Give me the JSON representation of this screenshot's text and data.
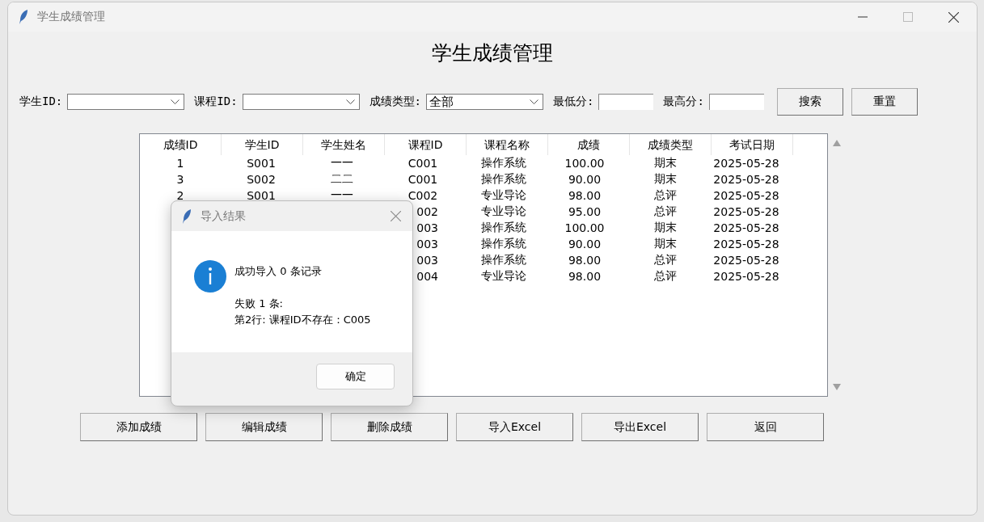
{
  "window": {
    "title": "学生成绩管理"
  },
  "heading": "学生成绩管理",
  "filters": [
    {
      "kind": "combo",
      "label": "学生ID:"
    },
    {
      "kind": "combo",
      "label": "课程ID:"
    },
    {
      "kind": "combo",
      "label": "成绩类型:",
      "value": "全部"
    },
    {
      "kind": "entry",
      "label": "最低分:"
    },
    {
      "kind": "entry",
      "label": "最高分:"
    }
  ],
  "filter_buttons": [
    "搜索",
    "重置"
  ],
  "table": {
    "columns": [
      "成绩ID",
      "学生ID",
      "学生姓名",
      "课程ID",
      "课程名称",
      "成绩",
      "成绩类型",
      "考试日期"
    ],
    "rows": [
      [
        "1",
        "S001",
        "一一",
        "C001",
        "操作系统",
        "100.00",
        "期末",
        "2025-05-28"
      ],
      [
        "3",
        "S002",
        "二二",
        "C001",
        "操作系统",
        "90.00",
        "期末",
        "2025-05-28"
      ],
      [
        "2",
        "S001",
        "一一",
        "C002",
        "专业导论",
        "98.00",
        "总评",
        "2025-05-28"
      ],
      [
        null,
        null,
        null,
        "002",
        "专业导论",
        "95.00",
        "总评",
        "2025-05-28"
      ],
      [
        null,
        null,
        null,
        "003",
        "操作系统",
        "100.00",
        "期末",
        "2025-05-28"
      ],
      [
        null,
        null,
        null,
        "003",
        "操作系统",
        "90.00",
        "期末",
        "2025-05-28"
      ],
      [
        null,
        null,
        null,
        "003",
        "操作系统",
        "98.00",
        "总评",
        "2025-05-28"
      ],
      [
        null,
        null,
        null,
        "004",
        "专业导论",
        "98.00",
        "总评",
        "2025-05-28"
      ]
    ]
  },
  "actions": [
    "添加成绩",
    "编辑成绩",
    "删除成绩",
    "导入Excel",
    "导出Excel",
    "返回"
  ],
  "dialog": {
    "title": "导入结果",
    "message": "成功导入 0 条记录",
    "details": [
      "失败 1 条:",
      "第2行: 课程ID不存在：C005"
    ],
    "button": "确定"
  }
}
